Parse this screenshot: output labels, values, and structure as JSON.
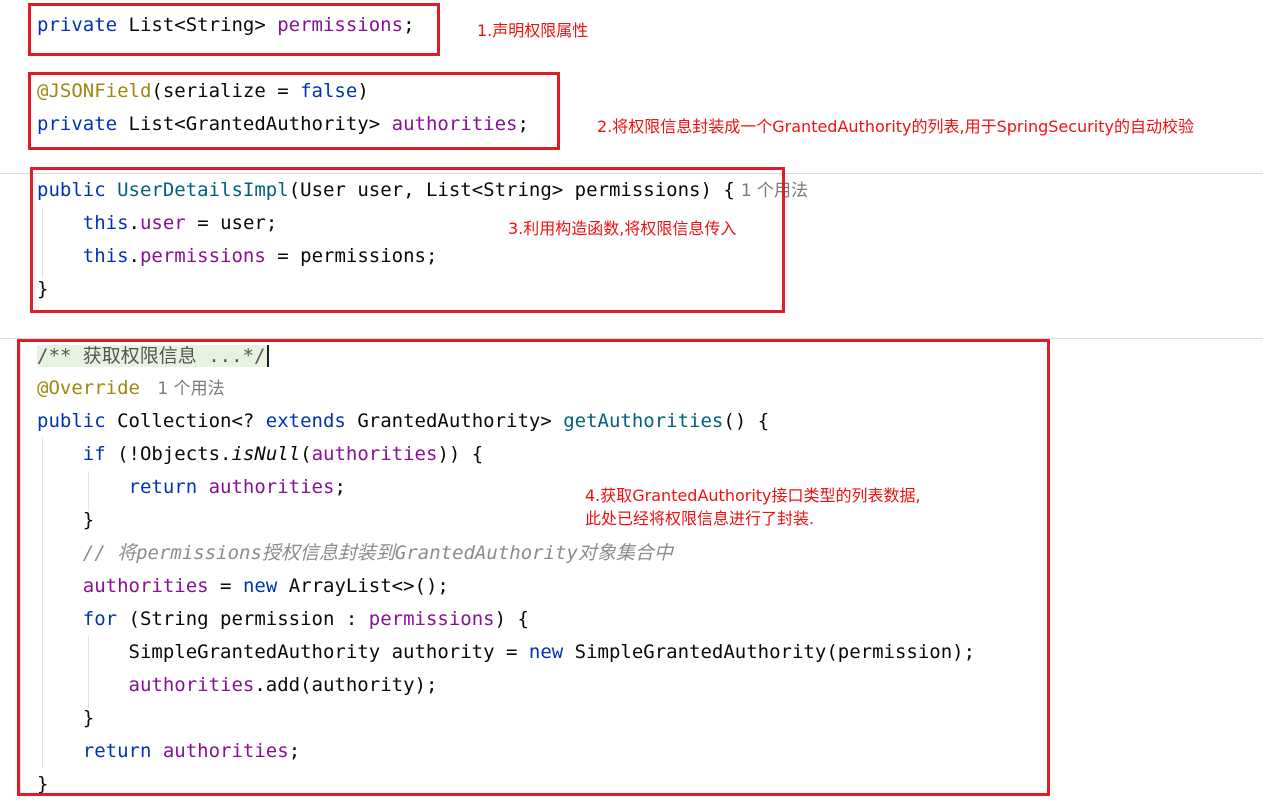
{
  "block1": {
    "line1": {
      "kw": "private",
      "type": " List<String> ",
      "field": "permissions",
      "end": ";"
    }
  },
  "block2": {
    "line1": {
      "annotation": "@JSONField",
      "open": "(serialize = ",
      "value": "false",
      "close": ")"
    },
    "line2": {
      "kw": "private",
      "type": " List<GrantedAuthority> ",
      "field": "authorities",
      "end": ";"
    }
  },
  "block3": {
    "line1": {
      "kw": "public",
      "name": "UserDetailsImpl",
      "params": "(User user, List<String> permissions) {",
      "usages": "1 个用法"
    },
    "line2": {
      "kw": "this",
      "dot": ".",
      "field": "user",
      "rest": " = user;"
    },
    "line3": {
      "kw": "this",
      "dot": ".",
      "field": "permissions",
      "rest": " = permissions;"
    },
    "line4": "}"
  },
  "block4": {
    "doc": "/** 获取权限信息 ...*/",
    "override": "@Override",
    "override_usages": "1 个用法",
    "sig": {
      "kw": "public",
      "t1": " Collection<? ",
      "ext": "extends",
      "t2": " GrantedAuthority> ",
      "name": "getAuthorities",
      "rest": "() {"
    },
    "if": {
      "kw": "if",
      "a": " (!Objects.",
      "call": "isNull",
      "b": "(",
      "field": "authorities",
      "c": ")) {"
    },
    "ret1": {
      "kw": "return",
      "field": "authorities",
      "end": ";"
    },
    "close1": "}",
    "comment": "// 将permissions授权信息封装到GrantedAuthority对象集合中",
    "assign": {
      "field": "authorities",
      "a": " = ",
      "kw": "new",
      "b": " ArrayList<>();"
    },
    "for": {
      "kw": "for",
      "a": " (String permission : ",
      "field": "permissions",
      "b": ") {"
    },
    "simple": {
      "a": "SimpleGrantedAuthority authority = ",
      "kw": "new",
      "b": " SimpleGrantedAuthority(permission);"
    },
    "add": {
      "field": "authorities",
      "b": ".add(authority);"
    },
    "close2": "}",
    "ret2": {
      "kw": "return",
      "field": "authorities",
      "end": ";"
    },
    "close3": "}"
  },
  "notes": {
    "n1": "1.声明权限属性",
    "n2": "2.将权限信息封装成一个GrantedAuthority的列表,用于SpringSecurity的自动校验",
    "n3": "3.利用构造函数,将权限信息传入",
    "n4_line1": "4.获取GrantedAuthority接口类型的列表数据,",
    "n4_line2": "此处已经将权限信息进行了封装."
  },
  "colors": {
    "keyword": "#0033b3",
    "field": "#871094",
    "annotation": "#9e880d",
    "method": "#00627a",
    "comment": "#8c8c8c",
    "highlight_box": "#e01c24",
    "note_text": "#ee1111"
  }
}
